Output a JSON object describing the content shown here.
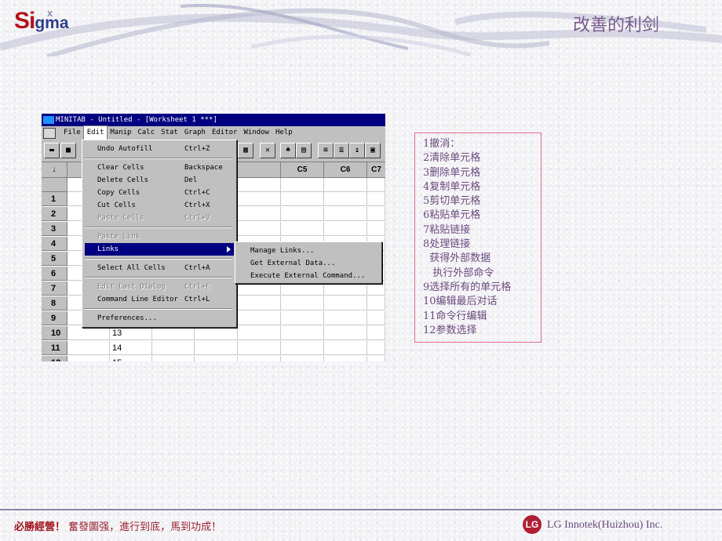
{
  "header": {
    "logo_main": "Si",
    "logo_tail": "gma",
    "logo_x": "x",
    "slide_title": "改善的利剑"
  },
  "footer": {
    "slogan_bold": "必勝經營！",
    "slogan_rest": "奮發圖强，進行到底，馬到功成！",
    "company": "LG Innotek(Huizhou) Inc.",
    "logo_text": "LG"
  },
  "minitab": {
    "title": "MINITAB - Untitled - [Worksheet 1 ***]",
    "menus": [
      "File",
      "Edit",
      "Manip",
      "Calc",
      "Stat",
      "Graph",
      "Editor",
      "Window",
      "Help"
    ],
    "active_menu": "Edit",
    "column_headers": [
      "C5",
      "C6",
      "C7"
    ],
    "row_numbers": [
      "1",
      "2",
      "3",
      "4",
      "5",
      "6",
      "7",
      "8",
      "9",
      "10",
      "11",
      "12"
    ],
    "visible_cell_values": [
      "13",
      "14",
      "15"
    ],
    "corner_arrow": "↓",
    "edit_menu": [
      {
        "label": "Undo Autofill",
        "shortcut": "Ctrl+Z",
        "enabled": true
      },
      {
        "separator": true
      },
      {
        "label": "Clear Cells",
        "shortcut": "Backspace",
        "enabled": true
      },
      {
        "label": "Delete Cells",
        "shortcut": "Del",
        "enabled": true
      },
      {
        "label": "Copy Cells",
        "shortcut": "Ctrl+C",
        "enabled": true
      },
      {
        "label": "Cut Cells",
        "shortcut": "Ctrl+X",
        "enabled": true
      },
      {
        "label": "Paste Cells",
        "shortcut": "Ctrl+V",
        "enabled": false
      },
      {
        "separator": true
      },
      {
        "label": "Paste Link",
        "shortcut": "",
        "enabled": false
      },
      {
        "label": "Links",
        "shortcut": "",
        "enabled": true,
        "selected": true,
        "submenu": true
      },
      {
        "separator": true
      },
      {
        "label": "Select All Cells",
        "shortcut": "Ctrl+A",
        "enabled": true
      },
      {
        "separator": true
      },
      {
        "label": "Edit Last Dialog",
        "shortcut": "Ctrl+E",
        "enabled": false
      },
      {
        "label": "Command Line Editor",
        "shortcut": "Ctrl+L",
        "enabled": true
      },
      {
        "separator": true
      },
      {
        "label": "Preferences...",
        "shortcut": "",
        "enabled": true
      }
    ],
    "links_submenu": [
      "Manage Links...",
      "Get External Data...",
      "Execute External Command..."
    ]
  },
  "notes": [
    "1撤消：",
    "2清除单元格",
    "3删除单元格",
    "4复制单元格",
    "5剪切单元格",
    "6粘贴单元格",
    "7粘贴链接",
    "8处理链接",
    "  获得外部数据",
    "   执行外部命令",
    "9选择所有的单元格",
    "10编辑最后对话",
    "11命令行编辑",
    "12参数选择"
  ]
}
